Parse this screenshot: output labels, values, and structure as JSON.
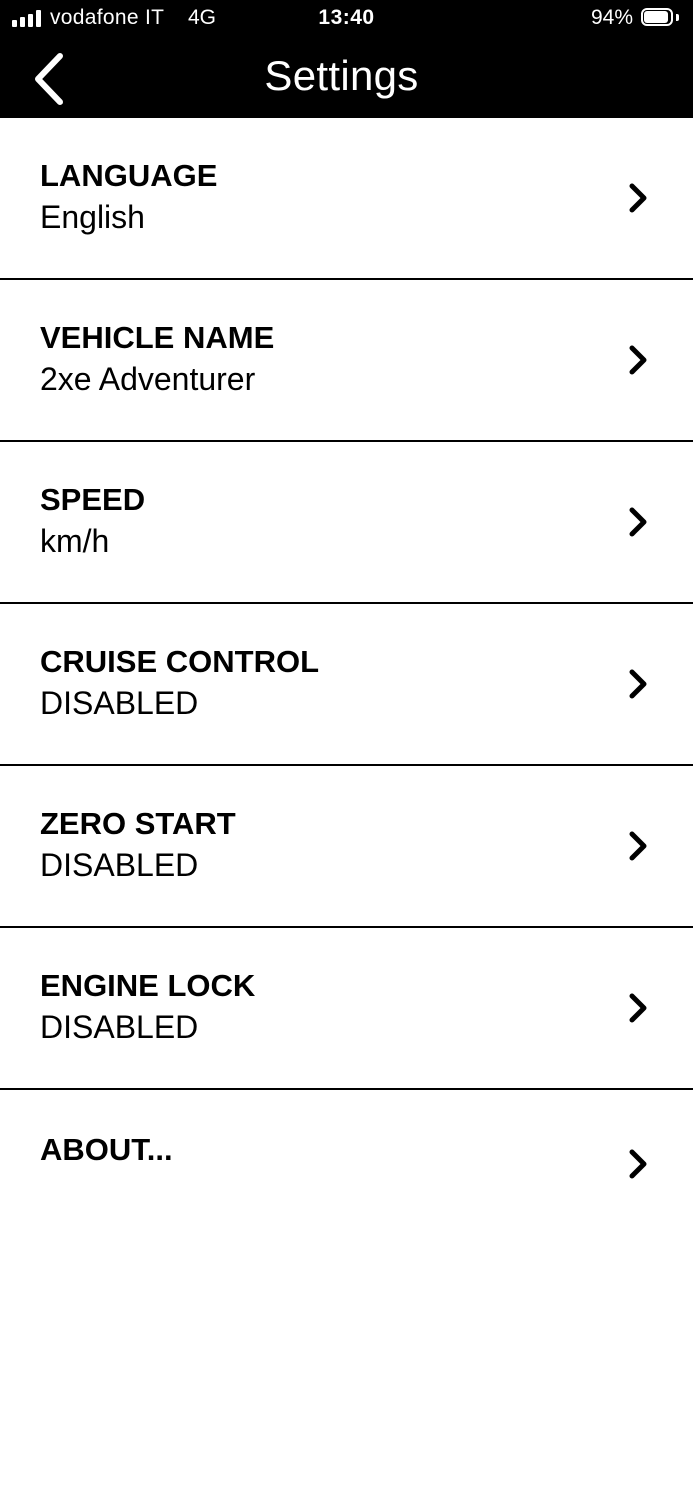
{
  "status_bar": {
    "carrier": "vodafone IT",
    "network": "4G",
    "time": "13:40",
    "battery_percent": "94%",
    "battery_level": 0.94,
    "signal_bars": 4
  },
  "header": {
    "title": "Settings",
    "back_icon": "chevron-left-icon",
    "background_color": "#000000",
    "text_color": "#ffffff"
  },
  "settings": [
    {
      "label": "LANGUAGE",
      "value": "English",
      "icon": "chevron-right-icon"
    },
    {
      "label": "VEHICLE NAME",
      "value": "2xe Adventurer",
      "icon": "chevron-right-icon"
    },
    {
      "label": "SPEED",
      "value": "km/h",
      "icon": "chevron-right-icon"
    },
    {
      "label": "CRUISE CONTROL",
      "value": "DISABLED",
      "icon": "chevron-right-icon"
    },
    {
      "label": "ZERO START",
      "value": "DISABLED",
      "icon": "chevron-right-icon"
    },
    {
      "label": "ENGINE LOCK",
      "value": "DISABLED",
      "icon": "chevron-right-icon"
    },
    {
      "label": "ABOUT...",
      "icon": "chevron-right-icon"
    }
  ]
}
